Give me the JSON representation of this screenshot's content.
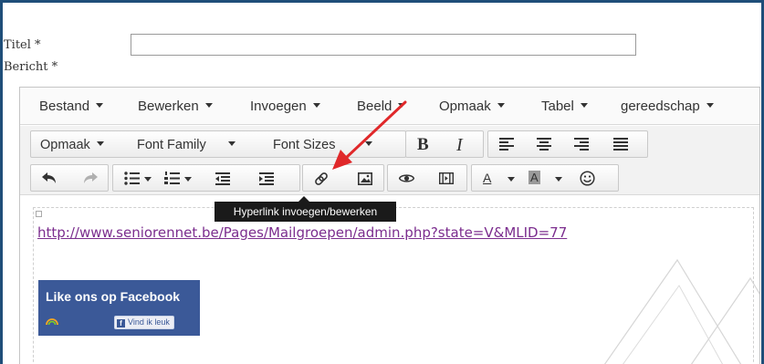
{
  "form": {
    "title_label": "Titel *",
    "title_value": "",
    "message_label": "Bericht *"
  },
  "menubar": {
    "items": [
      "Bestand",
      "Bewerken",
      "Invoegen",
      "Beeld",
      "Opmaak",
      "Tabel",
      "gereedschap"
    ]
  },
  "toolbar1": {
    "format_label": "Opmaak",
    "font_family_label": "Font Family",
    "font_size_label": "Font Sizes",
    "bold_icon": "B",
    "italic_icon": "I",
    "icons": [
      "bold-icon",
      "italic-icon",
      "align-left-icon",
      "align-center-icon",
      "align-right-icon",
      "align-justify-icon"
    ]
  },
  "toolbar2": {
    "icons": [
      "undo-icon",
      "redo-icon",
      "bullet-list-icon",
      "numbered-list-icon",
      "outdent-icon",
      "indent-icon",
      "link-icon",
      "image-icon",
      "preview-icon",
      "media-icon",
      "text-color-icon",
      "background-color-icon",
      "emoticon-icon"
    ],
    "text_color_glyph": "A",
    "background_color_glyph": "A",
    "text_color": "#e74c3c",
    "background_color": "#888888"
  },
  "tooltip": {
    "text": "Hyperlink invoegen/bewerken"
  },
  "content": {
    "link_url": "http://www.seniorennet.be/Pages/Mailgroepen/admin.php?state=V&MLID=77",
    "fb_title": "Like ons op Facebook",
    "fb_button": "Vind ik leuk",
    "fb_f": "f"
  },
  "colors": {
    "accent_frame": "#1f4e79",
    "link": "#7b2d8e",
    "facebook": "#3b5998",
    "arrow": "#e0282a"
  }
}
